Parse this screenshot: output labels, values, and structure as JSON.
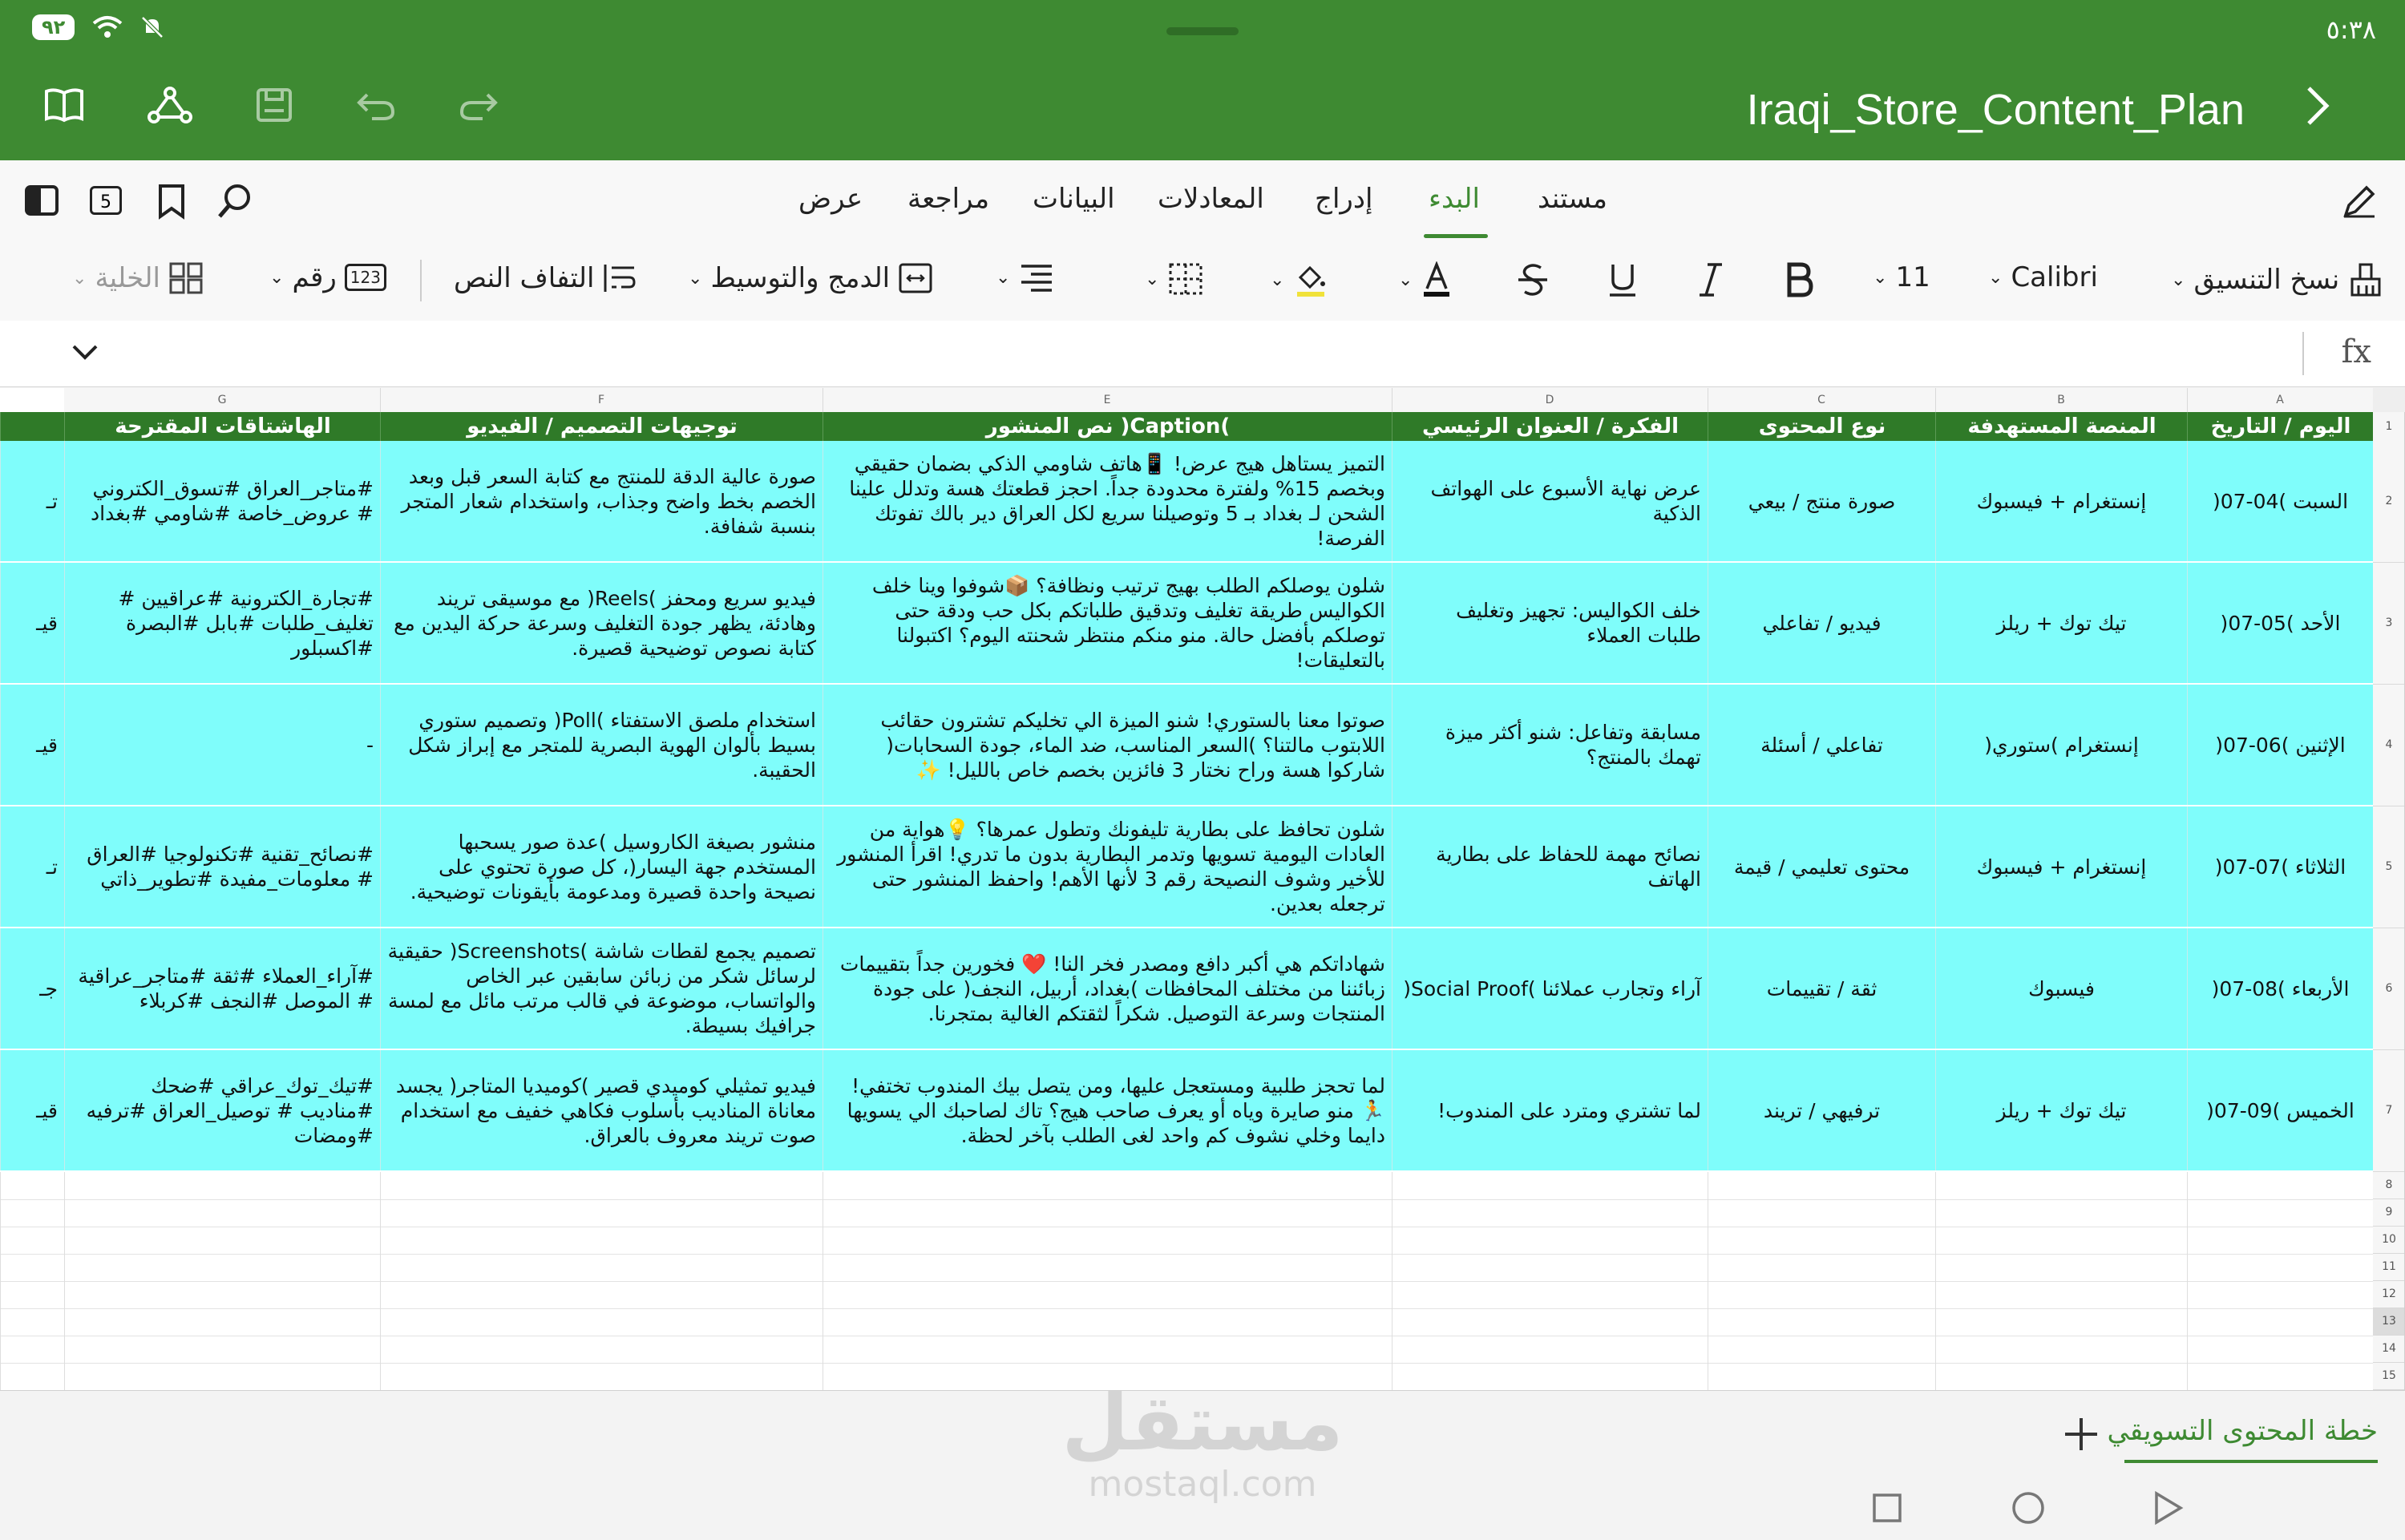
{
  "status": {
    "time": "٥:٣٨",
    "battery": "٩٢"
  },
  "titlebar": {
    "doc_title": "Iraqi_Store_Content_Plan"
  },
  "tabs": [
    {
      "label": "مستند",
      "active": false
    },
    {
      "label": "البدء",
      "active": true
    },
    {
      "label": "إدراج",
      "active": false
    },
    {
      "label": "المعادلات",
      "active": false
    },
    {
      "label": "البيانات",
      "active": false
    },
    {
      "label": "مراجعة",
      "active": false
    },
    {
      "label": "عرض",
      "active": false
    }
  ],
  "tabbar_left": {
    "sheet_count": "5"
  },
  "ribbon": {
    "format_painter": "نسخ التنسيق",
    "font": "Calibri",
    "size": "11",
    "merge": "الدمج والتوسيط",
    "wrap": "التفاف النص",
    "number": "رقم",
    "number_icon": "123",
    "cell": "الخلية"
  },
  "formula": {
    "fx": "fx"
  },
  "columns": [
    "A",
    "B",
    "C",
    "D",
    "E",
    "F",
    "G"
  ],
  "headers": {
    "A": "اليوم / التاريخ",
    "B": "المنصة المستهدفة",
    "C": "نوع المحتوى",
    "D": "الفكرة / العنوان الرئيسي",
    "E": "نص المنشور )Caption(",
    "F": "توجيهات التصميم / الفيديو",
    "G": "الهاشتاقات المقترحة"
  },
  "rows": [
    {
      "num": "2",
      "A": "السبت )04-07(",
      "B": "إنستغرام + فيسبوك",
      "C": "صورة منتج / بيعي",
      "D": "عرض نهاية الأسبوع على الهواتف الذكية",
      "E": "التميز يستاهل هيج عرض! 📱هاتف شاومي الذكي بضمان حقيقي وبخصم 15% ولفترة محدودة جداً. احجز قطعتك هسة وتدلل علينا الشحن لـ بغداد بـ 5 وتوصيلنا سريع لكل العراق دير بالك تفوتك الفرصة!",
      "F": "صورة عالية الدقة للمنتج مع كتابة السعر قبل وبعد الخصم بخط واضح وجذاب، واستخدام شعار المتجر بنسبة شفافة.",
      "G": "#متاجر_العراق #تسوق_الكتروني # عروض_خاصة #شاومي #بغداد",
      "H": "تـ"
    },
    {
      "num": "3",
      "A": "الأحد )05-07(",
      "B": "تيك توك + ريلز",
      "C": "فيديو / تفاعلي",
      "D": "خلف الكواليس: تجهيز وتغليف طلبات العملاء",
      "E": "شلون يوصلكم الطلب بهيج ترتيب ونظافة؟ 📦شوفوا وينا خلف الكواليس طريقة تغليف وتدقيق طلباتكم بكل حب ودقة حتى توصلكم بأفضل حالة. منو منكم منتظر شحنته اليوم؟ اكتبولنا بالتعليقات!",
      "F": "فيديو سريع ومحفز )Reels( مع موسيقى تريند وهادئة، يظهر جودة التغليف وسرعة حركة اليدين مع كتابة نصوص توضيحية قصيرة.",
      "G": "#تجارة_الكترونية #عراقيين # تغليف_طلبات #بابل #البصرة #اكسبلور",
      "H": "قيـ"
    },
    {
      "num": "4",
      "A": "الإثنين )06-07(",
      "B": "إنستغرام )ستوري(",
      "C": "تفاعلي / أسئلة",
      "D": "مسابقة وتفاعل: شنو أكثر ميزة تهمك بالمنتج؟",
      "E": "صوتوا معنا بالستوري! شنو الميزة الي تخليكم تشترون حقائب اللابتوب مالتنا؟ )السعر المناسب، ضد الماء، جودة السحابات( شاركوا هسة وراح نختار 3 فائزين بخصم خاص بالليل! ✨",
      "F": "استخدام ملصق الاستفتاء )Poll( وتصميم ستوري بسيط بألوان الهوية البصرية للمتجر مع إبراز شكل الحقيبة.",
      "G": "-",
      "H": "قيـ"
    },
    {
      "num": "5",
      "A": "الثلاثاء )07-07(",
      "B": "إنستغرام + فيسبوك",
      "C": "محتوى تعليمي / قيمة",
      "D": "نصائح مهمة للحفاظ على بطارية الهاتف",
      "E": "شلون تحافظ على بطارية تليفونك وتطول عمرها؟ 💡هواية من العادات اليومية تسويها وتدمر البطارية بدون ما تدري! اقرأ المنشور للأخير وشوف النصيحة رقم 3 لأنها الأهم! واحفظ المنشور حتى ترجعله بعدين.",
      "F": "منشور بصيغة الكاروسيل )عدة صور يسحبها المستخدم جهة اليسار(، كل صورة تحتوي على نصيحة واحدة قصيرة ومدعومة بأيقونات توضيحية.",
      "G": "#نصائح_تقنية #تكنولوجيا #العراق # معلومات_مفيدة #تطوير_ذاتي",
      "H": "تـ"
    },
    {
      "num": "6",
      "A": "الأربعاء )08-07(",
      "B": "فيسبوك",
      "C": "ثقة / تقييمات",
      "D": "آراء وتجارب عملائنا )Social Proof(",
      "E": "شهاداتكم هي أكبر دافع ومصدر فخر النا! ❤️ فخورين جداً بتقييمات زبائننا من مختلف المحافظات )بغداد، أربيل، النجف( على جودة المنتجات وسرعة التوصيل. شكراً لثقتكم الغالية بمتجرنا.",
      "F": "تصميم يجمع لقطات شاشة )Screenshots( حقيقية لرسائل شكر من زبائن سابقين عبر الخاص والواتساب، موضوعة في قالب مرتب مائل مع لمسة جرافيك بسيطة.",
      "G": "#آراء_العملاء #ثقة #متاجر_عراقية # الموصل #النجف #كربلاء",
      "H": "جـ"
    },
    {
      "num": "7",
      "A": "الخميس )09-07(",
      "B": "تيك توك + ريلز",
      "C": "ترفيهي / تريند",
      "D": "لما تشتري ومترد على المندوب!",
      "E": "لما تحجز طلبية ومستعجل عليها، ومن يتصل بيك المندوب تختفي! 🏃 منو صايرة وياه أو يعرف صاحب هيج؟ تاك لصاحبك الي يسويها دايما وخلي نشوف كم واحد لغى الطلب بآخر لحظة.",
      "F": "فيديو تمثيلي كوميدي قصير )كوميديا المتاجر( يجسد معاناة المناديب بأسلوب فكاهي خفيف مع استخدام صوت تريند معروف بالعراق.",
      "G": "#تيك_توك_عراقي #ضحك #مناديب # توصيل_العراق #ترفيه #ومضات",
      "H": "قيـ"
    }
  ],
  "empty_rows": [
    "8",
    "9",
    "10",
    "11",
    "12",
    "13",
    "14",
    "15"
  ],
  "sheet_tab": "خطة المحتوى التسويقي",
  "watermark": {
    "ar": "مستقل",
    "en": "mostaql.com"
  }
}
